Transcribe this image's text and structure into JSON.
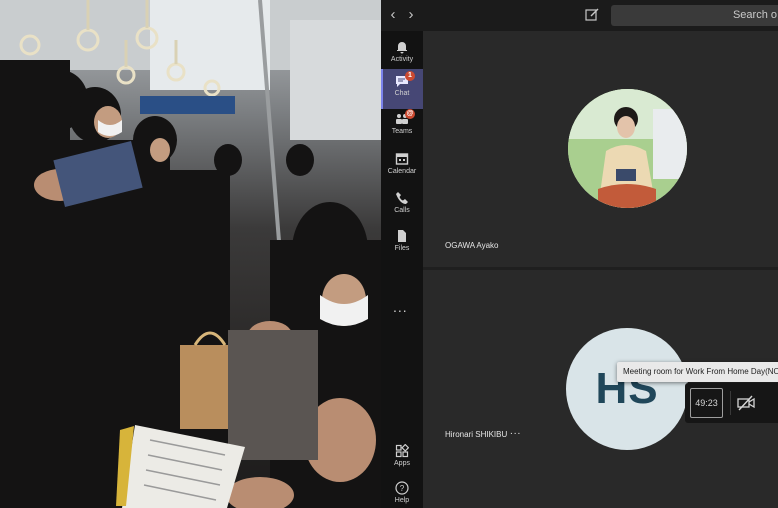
{
  "topbar": {
    "back_icon": "chevron-left-icon",
    "forward_icon": "chevron-right-icon",
    "compose_icon": "compose-icon",
    "search_placeholder": "Search o"
  },
  "rail": {
    "items": [
      {
        "label": "Activity",
        "icon": "bell-icon"
      },
      {
        "label": "Chat",
        "icon": "chat-icon",
        "badge": "1",
        "active": true
      },
      {
        "label": "Teams",
        "icon": "teams-icon",
        "badge": "@"
      },
      {
        "label": "Calendar",
        "icon": "calendar-icon"
      },
      {
        "label": "Calls",
        "icon": "phone-icon"
      },
      {
        "label": "Files",
        "icon": "file-icon"
      },
      {
        "label": "Apps",
        "icon": "apps-icon"
      },
      {
        "label": "Help",
        "icon": "help-icon"
      }
    ],
    "more": "..."
  },
  "participants": [
    {
      "name": "OGAWA Ayako",
      "avatar": "photo"
    },
    {
      "name": "Hironari SHIKIBU",
      "initials": "HS",
      "more": "..."
    }
  ],
  "meeting": {
    "tooltip": "Meeting room for Work From Home Day(NOT",
    "timer": "49:23",
    "camera_icon": "camera-off-icon"
  },
  "colors": {
    "rail_bg": "#121212",
    "active": "#464775",
    "accent": "#7b83eb",
    "badge": "#cc4a31",
    "tile": "#292929",
    "initials_bg": "#d9e4e8",
    "initials_fg": "#20475a"
  }
}
